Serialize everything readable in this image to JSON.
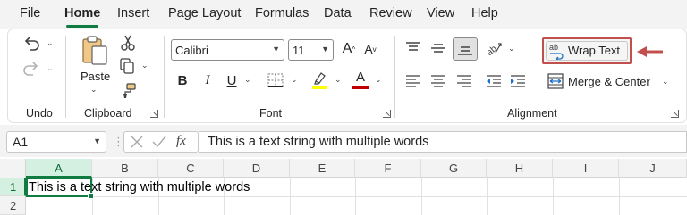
{
  "menu": {
    "items": [
      "File",
      "Home",
      "Insert",
      "Page Layout",
      "Formulas",
      "Data",
      "Review",
      "View",
      "Help"
    ],
    "active": "Home"
  },
  "ribbon": {
    "groups": {
      "undo": "Undo",
      "clipboard": "Clipboard",
      "font": "Font",
      "alignment": "Alignment"
    },
    "clipboard": {
      "paste_label": "Paste"
    },
    "font": {
      "font_name": "Calibri",
      "font_size": "11"
    },
    "alignment": {
      "wrap_text_label": "Wrap Text",
      "merge_center_label": "Merge & Center"
    }
  },
  "formula_bar": {
    "name_box": "A1",
    "fx": "fx",
    "content": "This is a text string with multiple words"
  },
  "grid": {
    "columns": [
      "A",
      "B",
      "C",
      "D",
      "E",
      "F",
      "G",
      "H",
      "I",
      "J"
    ],
    "rows": [
      "1",
      "2"
    ],
    "selected_column": "A",
    "selected_row": "1",
    "cells": {
      "A1": "This is a text string with multiple words"
    }
  },
  "colors": {
    "accent": "#107c41",
    "highlight_box": "#c0504d",
    "font_color": "#c00000",
    "highlight_color": "#ffff00"
  },
  "icons": [
    "undo-icon",
    "redo-icon",
    "paste-icon",
    "cut-icon",
    "copy-icon",
    "format-painter-icon",
    "grow-font-icon",
    "shrink-font-icon",
    "bold-icon",
    "italic-icon",
    "underline-icon",
    "borders-icon",
    "highlight-icon",
    "font-color-icon",
    "align-top-icon",
    "align-middle-icon",
    "align-bottom-icon",
    "orientation-icon",
    "wrap-text-icon",
    "align-left-icon",
    "align-center-icon",
    "align-right-icon",
    "decrease-indent-icon",
    "increase-indent-icon",
    "merge-center-icon",
    "cancel-icon",
    "enter-icon",
    "red-arrow-icon"
  ]
}
